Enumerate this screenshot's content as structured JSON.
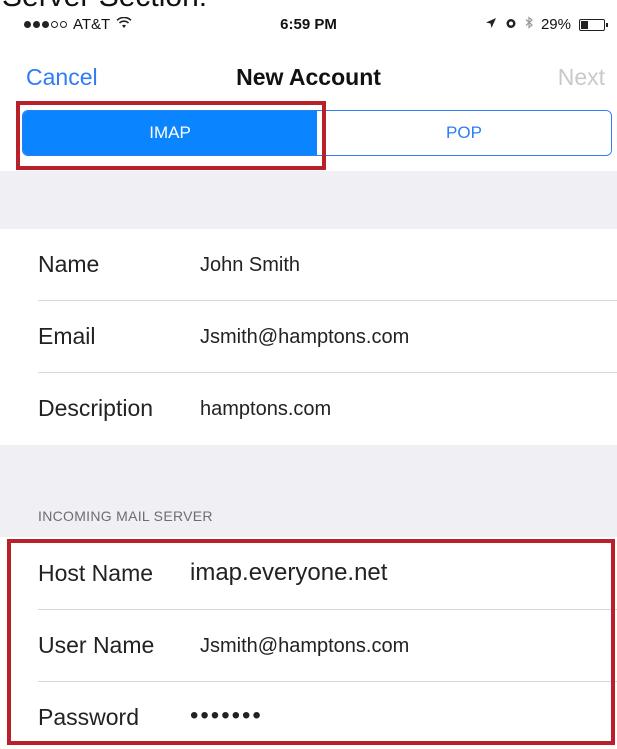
{
  "heading_fragment": "Server Section:",
  "status_bar": {
    "carrier": "AT&T",
    "time": "6:59 PM",
    "battery": "29%",
    "signal_bars_filled": 3,
    "signal_bars_total": 5,
    "battery_level": 0.29,
    "icons": [
      "wifi-icon",
      "location-arrow-icon",
      "alarm-icon",
      "bluetooth-icon",
      "battery-icon"
    ]
  },
  "nav": {
    "cancel_label": "Cancel",
    "title": "New Account",
    "next_label": "Next"
  },
  "segments": [
    {
      "label": "IMAP",
      "selected": true
    },
    {
      "label": "POP",
      "selected": false
    }
  ],
  "account": {
    "name_label": "Name",
    "name_value": "John Smith",
    "email_label": "Email",
    "email_value": "Jsmith@hamptons.com",
    "description_label": "Description",
    "description_value": "hamptons.com"
  },
  "incoming": {
    "section_title": "INCOMING MAIL SERVER",
    "host_label": "Host Name",
    "host_value": "imap.everyone.net",
    "user_label": "User Name",
    "user_value": "Jsmith@hamptons.com",
    "password_label": "Password",
    "password_value": "•••••••"
  },
  "colors": {
    "accent": "#2e7cf6",
    "segment_selected": "#0b84ff",
    "highlight_box": "#b8202a",
    "grouped_background": "#efeff4"
  }
}
